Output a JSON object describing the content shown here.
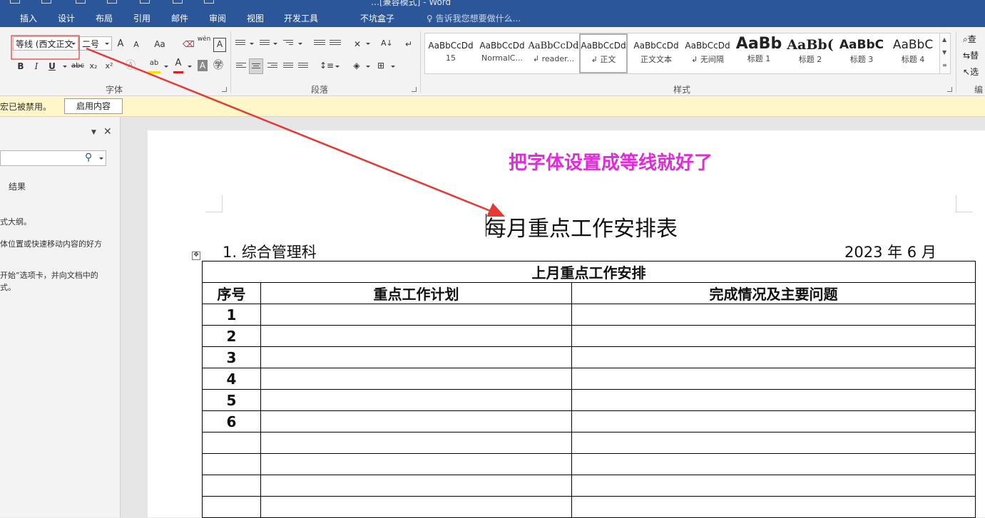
{
  "window": {
    "title_fragment": "…[兼容模式] - Word"
  },
  "tabs": [
    "插入",
    "设计",
    "布局",
    "引用",
    "邮件",
    "审阅",
    "视图",
    "开发工具",
    "不坑盒子"
  ],
  "tell_me": "告诉我您想要做什么...",
  "font_group": {
    "font_name": "等线 (西文正文",
    "font_size": "二号",
    "grow_label": "A",
    "shrink_label": "A",
    "case_label": "Aa",
    "pinyin_label": "wén",
    "bold": "B",
    "italic": "I",
    "underline": "U",
    "strike": "abc",
    "subscript": "x₂",
    "superscript": "x²",
    "label": "字体"
  },
  "paragraph_group": {
    "label": "段落"
  },
  "styles_group": {
    "label": "样式",
    "items": [
      {
        "preview": "AaBbCcDd",
        "name": "15"
      },
      {
        "preview": "AaBbCcDd",
        "name": "NormalC..."
      },
      {
        "preview": "AaBbCcDd",
        "name": "↲ reader..."
      },
      {
        "preview": "AaBbCcDd",
        "name": "↲ 正文"
      },
      {
        "preview": "AaBbCcDd",
        "name": "正文文本"
      },
      {
        "preview": "AaBbCcDd",
        "name": "↲ 无间隔"
      },
      {
        "preview": "AaBb",
        "name": "标题 1"
      },
      {
        "preview": "AaBb(",
        "name": "标题 2"
      },
      {
        "preview": "AaBbC",
        "name": "标题 3"
      },
      {
        "preview": "AaBbC",
        "name": "标题 4"
      }
    ],
    "selected_index": 3
  },
  "editing_group": {
    "find": "查",
    "replace": "替",
    "select": "选",
    "label": "编"
  },
  "message_bar": {
    "text": "宏已被禁用。",
    "button": "启用内容"
  },
  "nav_pane": {
    "results_label": "结果",
    "text1": "式大纲。",
    "text2": "体位置或快速移动内容的好方",
    "text3": "开始”选项卡，并向文档中的",
    "text4": "式。"
  },
  "annotation": "把字体设置成等线就好了",
  "document": {
    "title": "每月重点工作安排表",
    "section": "1. 综合管理科",
    "date": "2023 年 6  月",
    "table": {
      "caption": "上月重点工作安排",
      "headers": [
        "序号",
        "重点工作计划",
        "完成情况及主要问题"
      ],
      "rows": [
        [
          "1",
          "",
          ""
        ],
        [
          "2",
          "",
          ""
        ],
        [
          "3",
          "",
          ""
        ],
        [
          "4",
          "",
          ""
        ],
        [
          "5",
          "",
          ""
        ],
        [
          "6",
          "",
          ""
        ],
        [
          "",
          "",
          ""
        ],
        [
          "",
          "",
          ""
        ],
        [
          "",
          "",
          ""
        ],
        [
          "",
          "",
          ""
        ]
      ]
    }
  },
  "colors": {
    "ribbon_tab_bg": "#2b579a",
    "annotation": "#e02bd8",
    "arrow": "#e53935",
    "highlight_box": "#e53935",
    "message_bar_bg": "#fff7c9"
  }
}
